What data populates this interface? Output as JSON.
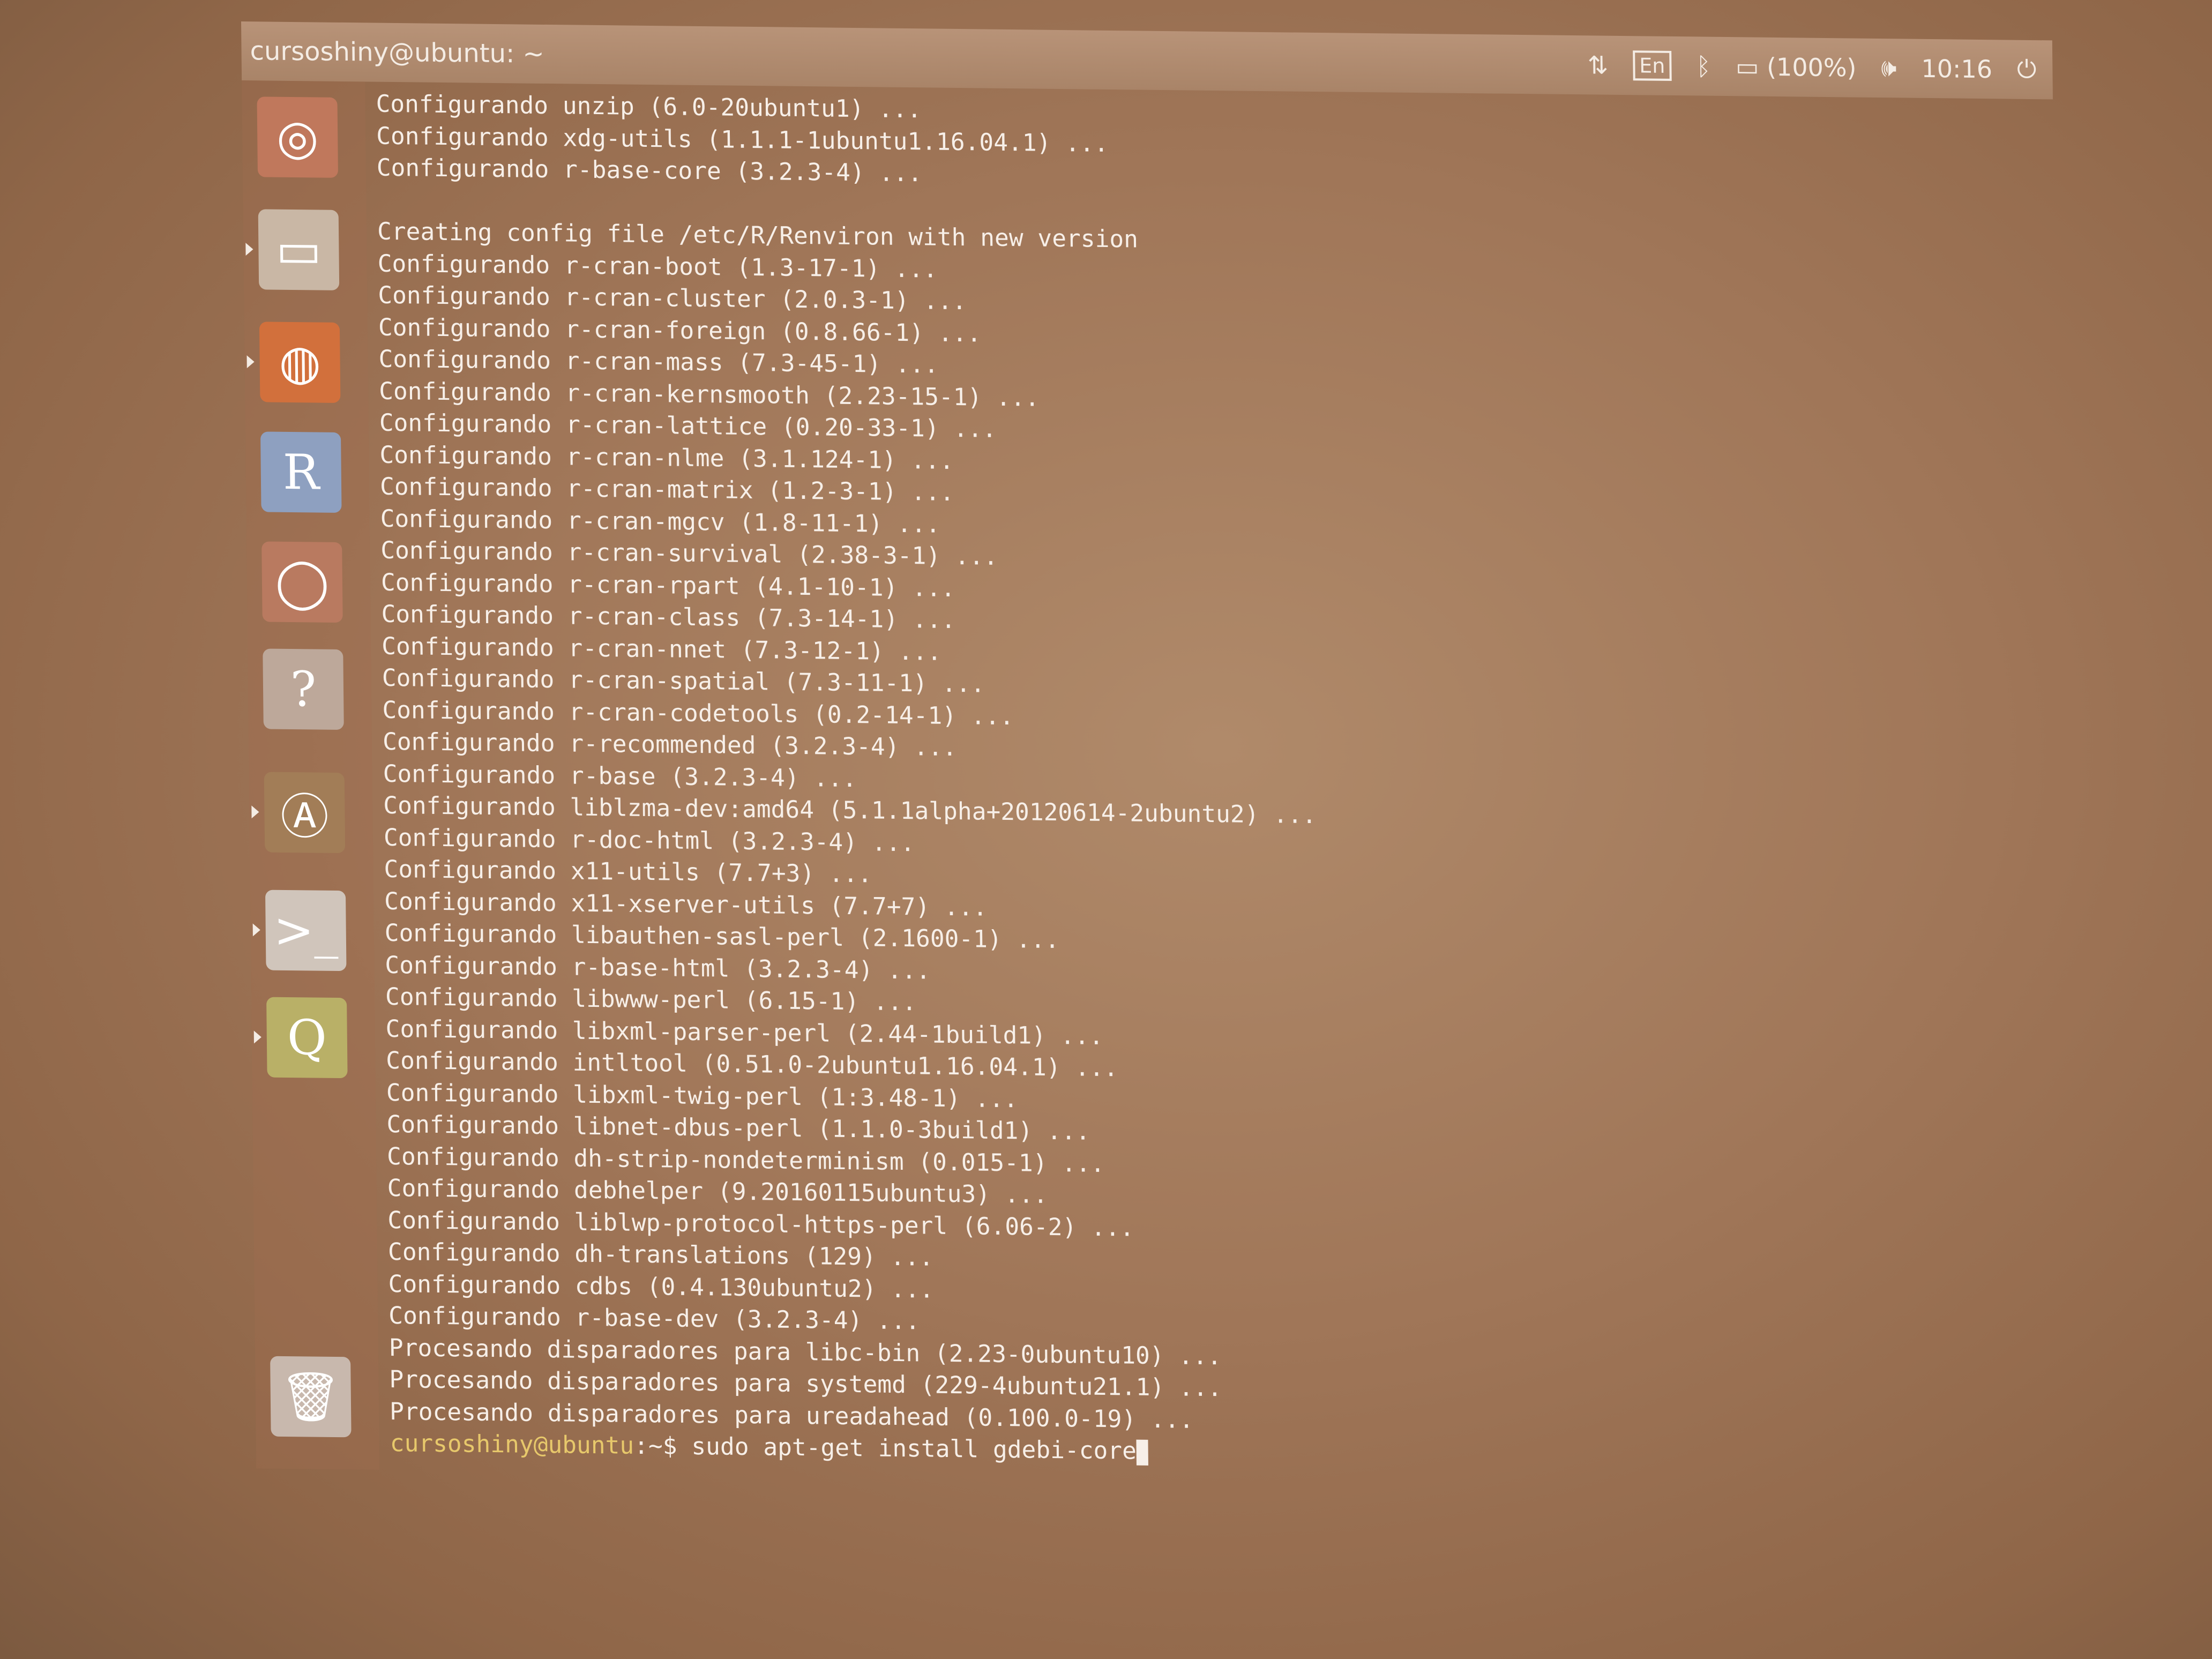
{
  "window": {
    "title": "cursoshiny@ubuntu: ~"
  },
  "indicators": {
    "network": "⇅",
    "keyboard_layout": "En",
    "bluetooth": "ᛒ",
    "battery": "(100%)",
    "volume": "🕪",
    "clock": "10:16",
    "power": "⏻"
  },
  "launcher": [
    {
      "name": "dash-icon",
      "glyph": "◎",
      "color": "#c0785c"
    },
    {
      "name": "files-icon",
      "glyph": "▭",
      "color": "#c9b7a5"
    },
    {
      "name": "firefox-icon",
      "glyph": "◍",
      "color": "#d2703c"
    },
    {
      "name": "r-icon",
      "glyph": "R",
      "color": "#8ea0c0"
    },
    {
      "name": "rstudio-icon",
      "glyph": "◯",
      "color": "#b97a60"
    },
    {
      "name": "help-icon",
      "glyph": "?",
      "color": "#bda89a"
    },
    {
      "name": "software-updater-icon",
      "glyph": "Ⓐ",
      "color": "#a27d57"
    },
    {
      "name": "terminal-icon",
      "glyph": ">_",
      "color": "#d0c5bb"
    },
    {
      "name": "qgis-icon",
      "glyph": "Q",
      "color": "#b9b067"
    },
    {
      "name": "trash-icon",
      "glyph": "🗑",
      "color": "#c8b8ad"
    }
  ],
  "terminal": {
    "lines": [
      "Configurando unzip (6.0-20ubuntu1) ...",
      "Configurando xdg-utils (1.1.1-1ubuntu1.16.04.1) ...",
      "Configurando r-base-core (3.2.3-4) ...",
      "",
      "Creating config file /etc/R/Renviron with new version",
      "Configurando r-cran-boot (1.3-17-1) ...",
      "Configurando r-cran-cluster (2.0.3-1) ...",
      "Configurando r-cran-foreign (0.8.66-1) ...",
      "Configurando r-cran-mass (7.3-45-1) ...",
      "Configurando r-cran-kernsmooth (2.23-15-1) ...",
      "Configurando r-cran-lattice (0.20-33-1) ...",
      "Configurando r-cran-nlme (3.1.124-1) ...",
      "Configurando r-cran-matrix (1.2-3-1) ...",
      "Configurando r-cran-mgcv (1.8-11-1) ...",
      "Configurando r-cran-survival (2.38-3-1) ...",
      "Configurando r-cran-rpart (4.1-10-1) ...",
      "Configurando r-cran-class (7.3-14-1) ...",
      "Configurando r-cran-nnet (7.3-12-1) ...",
      "Configurando r-cran-spatial (7.3-11-1) ...",
      "Configurando r-cran-codetools (0.2-14-1) ...",
      "Configurando r-recommended (3.2.3-4) ...",
      "Configurando r-base (3.2.3-4) ...",
      "Configurando liblzma-dev:amd64 (5.1.1alpha+20120614-2ubuntu2) ...",
      "Configurando r-doc-html (3.2.3-4) ...",
      "Configurando x11-utils (7.7+3) ...",
      "Configurando x11-xserver-utils (7.7+7) ...",
      "Configurando libauthen-sasl-perl (2.1600-1) ...",
      "Configurando r-base-html (3.2.3-4) ...",
      "Configurando libwww-perl (6.15-1) ...",
      "Configurando libxml-parser-perl (2.44-1build1) ...",
      "Configurando intltool (0.51.0-2ubuntu1.16.04.1) ...",
      "Configurando libxml-twig-perl (1:3.48-1) ...",
      "Configurando libnet-dbus-perl (1.1.0-3build1) ...",
      "Configurando dh-strip-nondeterminism (0.015-1) ...",
      "Configurando debhelper (9.20160115ubuntu3) ...",
      "Configurando liblwp-protocol-https-perl (6.06-2) ...",
      "Configurando dh-translations (129) ...",
      "Configurando cdbs (0.4.130ubuntu2) ...",
      "Configurando r-base-dev (3.2.3-4) ...",
      "Procesando disparadores para libc-bin (2.23-0ubuntu10) ...",
      "Procesando disparadores para systemd (229-4ubuntu21.1) ...",
      "Procesando disparadores para ureadahead (0.100.0-19) ..."
    ],
    "prompt_user": "cursoshiny@ubuntu",
    "prompt_suffix": ":~$ ",
    "command": "sudo apt-get install gdebi-core"
  }
}
